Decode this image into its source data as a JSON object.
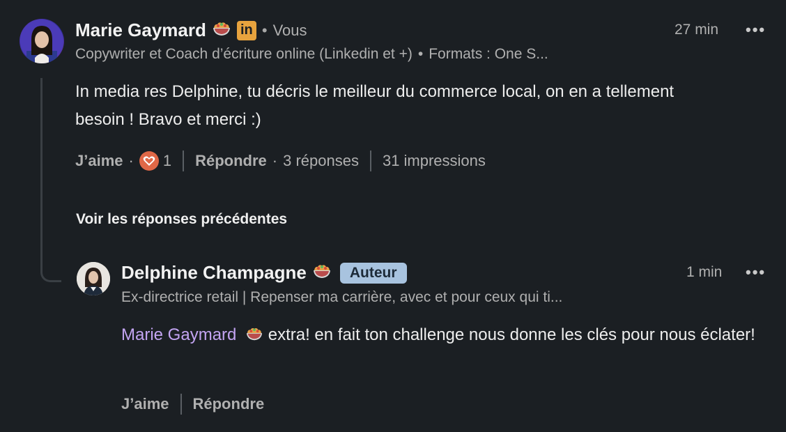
{
  "comment": {
    "author_name": "Marie Gaymard",
    "degree": "Vous",
    "time": "27 min",
    "headline": "Copywriter et Coach d’écriture online (Linkedin et +)",
    "headline_extra": "Formats : One S...",
    "text": "In media res Delphine, tu décris le meilleur du commerce local, on en a tellement besoin ! Bravo et merci :)",
    "like_label": "J’aime",
    "reaction_count": "1",
    "reply_label": "Répondre",
    "replies_count": "3 réponses",
    "impressions": "31 impressions"
  },
  "see_previous_label": "Voir les réponses précédentes",
  "reply": {
    "author_name": "Delphine Champagne",
    "author_badge": "Auteur",
    "time": "1 min",
    "headline": "Ex-directrice retail | Repenser ma carrière, avec et pour ceux qui ti...",
    "mention": "Marie Gaymard",
    "text_after_mention": " extra! en fait ton challenge nous donne les clés pour nous éclater!",
    "like_label": "J’aime",
    "reply_label": "Répondre"
  },
  "icons": {
    "linkedin": "in",
    "more": "•••"
  },
  "colors": {
    "background": "#1b1f23",
    "mention": "#c3a4f2",
    "author_badge_bg": "#a8c3df",
    "reaction_heart_bg": "#e06847",
    "linkedin_badge_bg": "#e7a33e"
  }
}
